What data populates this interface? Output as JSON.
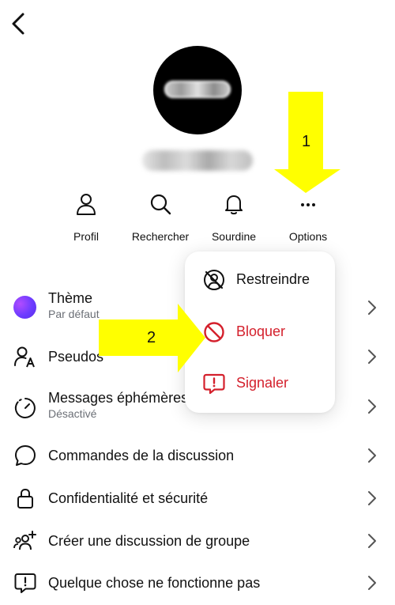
{
  "header": {
    "back_icon": "chevron-left-icon"
  },
  "actions": [
    {
      "label": "Profil",
      "icon": "person-icon"
    },
    {
      "label": "Rechercher",
      "icon": "search-icon"
    },
    {
      "label": "Sourdine",
      "icon": "bell-icon"
    },
    {
      "label": "Options",
      "icon": "more-icon"
    }
  ],
  "list": [
    {
      "title": "Thème",
      "subtitle": "Par défaut",
      "icon": "theme-color-icon"
    },
    {
      "title": "Pseudos",
      "icon": "nickname-icon"
    },
    {
      "title": "Messages éphémères",
      "subtitle": "Désactivé",
      "icon": "timer-icon"
    },
    {
      "title": "Commandes de la discussion",
      "icon": "chat-bubble-icon"
    },
    {
      "title": "Confidentialité et sécurité",
      "icon": "lock-icon"
    },
    {
      "title": "Créer une discussion de groupe",
      "icon": "add-group-icon"
    },
    {
      "title": "Quelque chose ne fonctionne pas",
      "icon": "report-bubble-icon"
    }
  ],
  "menu": {
    "items": [
      {
        "label": "Restreindre",
        "icon": "restrict-icon",
        "color": "#111111"
      },
      {
        "label": "Bloquer",
        "icon": "block-icon",
        "color": "#d4202c"
      },
      {
        "label": "Signaler",
        "icon": "report-icon",
        "color": "#d4202c"
      }
    ]
  },
  "annotations": {
    "step1": "1",
    "step2": "2",
    "arrow_color": "#ffff00"
  },
  "colors": {
    "accent_red": "#d4202c",
    "theme_purple": "#7b3cff",
    "muted": "#6b6f76"
  }
}
